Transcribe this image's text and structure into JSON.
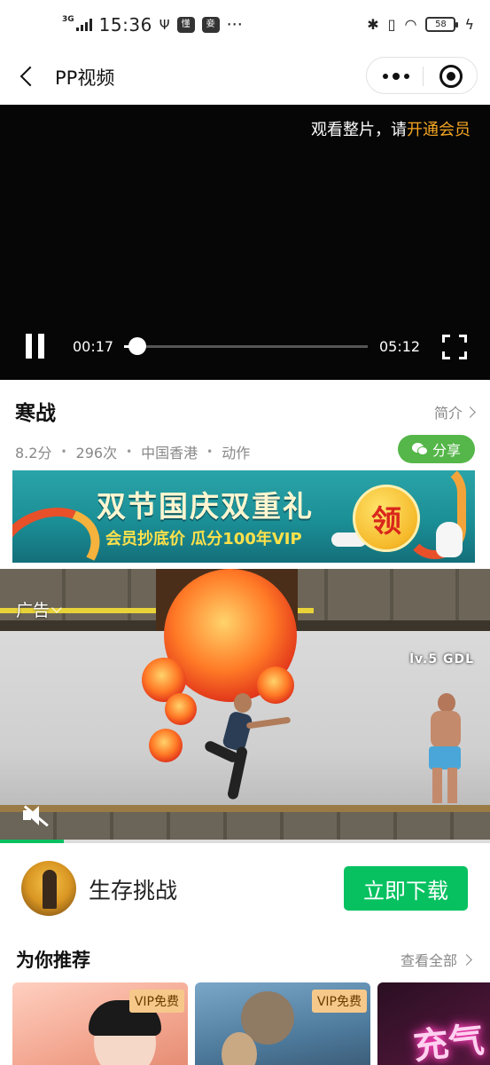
{
  "status_bar": {
    "network": "3G",
    "time": "15:36",
    "icons": [
      "usb-icon",
      "notification-icon",
      "notification-icon",
      "more-dots"
    ],
    "more": "···",
    "badge_a": "懂",
    "badge_b": "妾",
    "battery": "58"
  },
  "nav": {
    "title": "PP视频"
  },
  "player": {
    "vip_tip_prefix": "观看整片，请",
    "vip_tip_link": "开通会员",
    "current_time": "00:17",
    "total_time": "05:12",
    "progress_fraction": 0.055
  },
  "movie": {
    "title": "寒战",
    "intro_label": "简介",
    "score": "8.2分",
    "views": "296次",
    "region": "中国香港",
    "genre": "动作",
    "share_label": "分享"
  },
  "banner": {
    "title": "双节国庆双重礼",
    "subtitle": "会员抄底价  瓜分100年VIP",
    "coin_text": "领"
  },
  "ad": {
    "label": "广告",
    "level_text": "lv.5 GDL",
    "progress_fraction": 0.13
  },
  "app": {
    "name": "生存挑战",
    "download_label": "立即下载"
  },
  "recommend": {
    "title": "为你推荐",
    "view_all": "查看全部",
    "cards": [
      {
        "badge": "VIP免费"
      },
      {
        "badge": "VIP免费"
      },
      {
        "text": "充气"
      }
    ]
  },
  "colors": {
    "accent_green": "#07c160",
    "share_green": "#55b649",
    "vip_orange": "#f5a623"
  }
}
